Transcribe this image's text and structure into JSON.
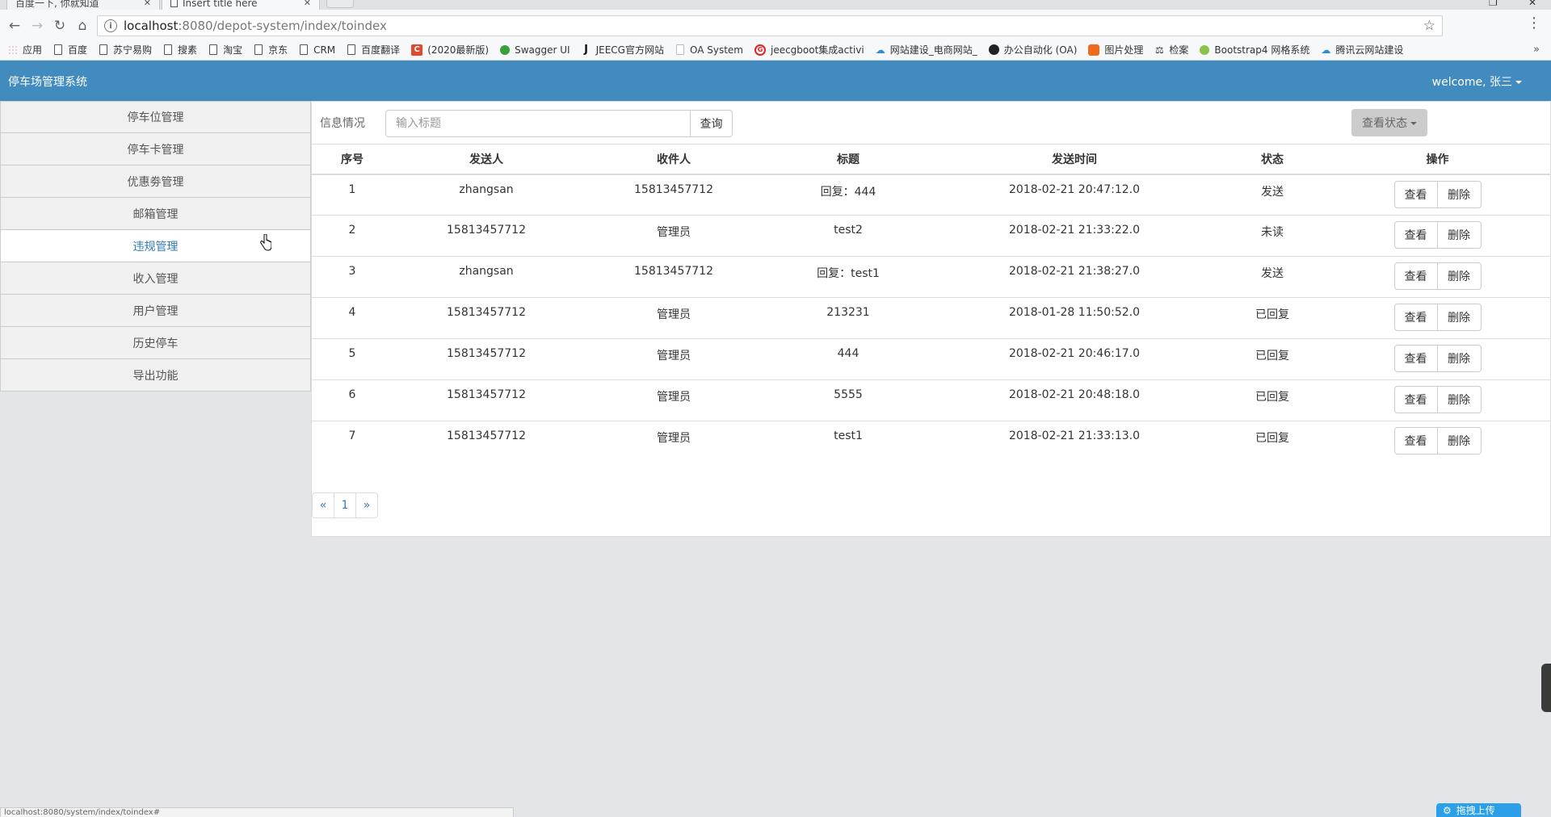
{
  "browser": {
    "tabs": [
      {
        "title": "百度一下, 你就知道"
      },
      {
        "title": "Insert title here"
      }
    ],
    "url_host": "localhost",
    "url_path": ":8080/depot-system/index/toindex",
    "bookmarks": [
      {
        "label": "应用",
        "icon": "apps-icon"
      },
      {
        "label": "百度",
        "icon": "page-icon"
      },
      {
        "label": "苏宁易购",
        "icon": "page-icon"
      },
      {
        "label": "搜素",
        "icon": "page-icon"
      },
      {
        "label": "淘宝",
        "icon": "page-icon"
      },
      {
        "label": "京东",
        "icon": "page-icon"
      },
      {
        "label": "CRM",
        "icon": "page-icon"
      },
      {
        "label": "百度翻译",
        "icon": "page-icon"
      },
      {
        "label": "(2020最新版)",
        "icon": "c-logo-icon"
      },
      {
        "label": "Swagger UI",
        "icon": "swagger-icon"
      },
      {
        "label": "JEECG官方网站",
        "icon": "j-logo-icon"
      },
      {
        "label": "OA System",
        "icon": "page-icon"
      },
      {
        "label": "jeecgboot集成activi",
        "icon": "g-logo-icon"
      },
      {
        "label": "网站建设_电商网站_",
        "icon": "cloud-icon"
      },
      {
        "label": "办公自动化 (OA)",
        "icon": "github-icon"
      },
      {
        "label": "图片处理",
        "icon": "orange-icon"
      },
      {
        "label": "检案",
        "icon": "seal-icon"
      },
      {
        "label": "Bootstrap4 网格系统",
        "icon": "green-icon"
      },
      {
        "label": "腾讯云网站建设",
        "icon": "cloud-icon"
      }
    ]
  },
  "header": {
    "brand": "停车场管理系统",
    "welcome": "welcome, 张三"
  },
  "sidebar": {
    "items": [
      {
        "label": "停车位管理",
        "active": false
      },
      {
        "label": "停车卡管理",
        "active": false
      },
      {
        "label": "优惠劵管理",
        "active": false
      },
      {
        "label": "邮箱管理",
        "active": false
      },
      {
        "label": "违规管理",
        "active": true
      },
      {
        "label": "收入管理",
        "active": false
      },
      {
        "label": "用户管理",
        "active": false
      },
      {
        "label": "历史停车",
        "active": false
      },
      {
        "label": "导出功能",
        "active": false
      }
    ]
  },
  "search": {
    "label": "信息情况",
    "placeholder": "输入标题",
    "button": "查询",
    "status_button": "查看状态"
  },
  "table": {
    "columns": [
      "序号",
      "发送人",
      "收件人",
      "标题",
      "发送时间",
      "状态",
      "操作"
    ],
    "rows": [
      [
        "1",
        "zhangsan",
        "15813457712",
        "回复：444",
        "2018-02-21 20:47:12.0",
        "发送"
      ],
      [
        "2",
        "15813457712",
        "管理员",
        "test2",
        "2018-02-21 21:33:22.0",
        "未读"
      ],
      [
        "3",
        "zhangsan",
        "15813457712",
        "回复：test1",
        "2018-02-21 21:38:27.0",
        "发送"
      ],
      [
        "4",
        "15813457712",
        "管理员",
        "213231",
        "2018-01-28 11:50:52.0",
        "已回复"
      ],
      [
        "5",
        "15813457712",
        "管理员",
        "444",
        "2018-02-21 20:46:17.0",
        "已回复"
      ],
      [
        "6",
        "15813457712",
        "管理员",
        "5555",
        "2018-02-21 20:48:18.0",
        "已回复"
      ],
      [
        "7",
        "15813457712",
        "管理员",
        "test1",
        "2018-02-21 21:33:13.0",
        "已回复"
      ]
    ],
    "view_label": "查看",
    "delete_label": "删除"
  },
  "pager": {
    "prev": "«",
    "page": "1",
    "next": "»"
  },
  "statusbar_text": "localhost:8080/system/index/toindex#",
  "upload_widget": "拖拽上传",
  "colors": {
    "header_bg": "#428bbf",
    "active_link": "#337ab7"
  }
}
